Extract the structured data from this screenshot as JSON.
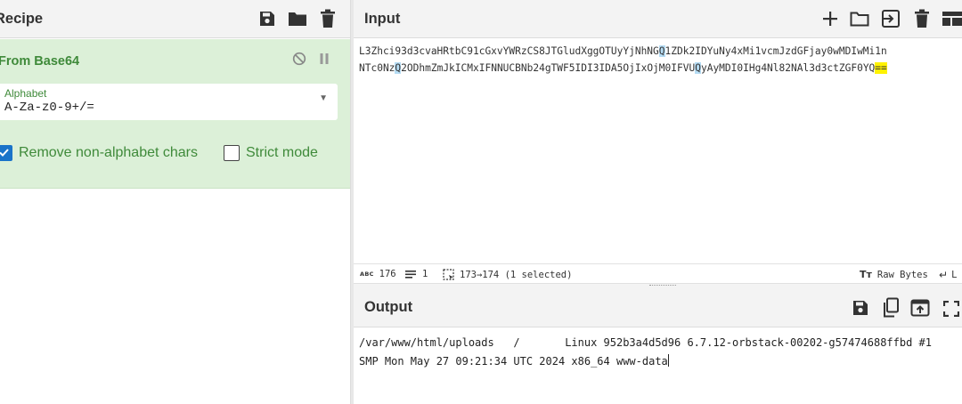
{
  "recipe": {
    "title": "Recipe",
    "operation": {
      "name": "From Base64",
      "alphabet_label": "Alphabet",
      "alphabet_value": "A-Za-z0-9+/=",
      "remove_non_alpha_label": "Remove non-alphabet chars",
      "remove_non_alpha_checked": true,
      "strict_mode_label": "Strict mode",
      "strict_mode_checked": false
    }
  },
  "input": {
    "title": "Input",
    "line1": {
      "a": "L3Zhci93d3cvaHRtbC91cGxvYWRzCS8JTGludXggOTUyYjNhNG",
      "b": "Q",
      "c": "1ZDk2IDYuNy4xMi1vcmJzdGFjay0wMDIwMi1n"
    },
    "line2": {
      "a": "NTc0Nz",
      "b": "Q",
      "c": "2ODhmZmJkICMxIFNNUCBNb24gTWF5IDI3IDA5OjIxOjM0IFVU",
      "d": "Q",
      "e": "yAyMDI0IHg4Nl82NAl3d3ctZGF0YQ",
      "f": "=="
    },
    "status": {
      "length_icon": "abc-icon",
      "length": "176",
      "lines": "1",
      "selection": "173→174 (1 selected)",
      "raw_bytes": "Raw Bytes",
      "line_break_icon": "return-arrow-icon",
      "line_break_text": "L"
    }
  },
  "output": {
    "title": "Output",
    "line1": "/var/www/html/uploads\t/\tLinux 952b3a4d5d96 6.7.12-orbstack-00202-g57474688ffbd #1",
    "line2": "SMP Mon May 27 09:21:34 UTC 2024 x86_64 www-data"
  },
  "colors": {
    "accent_green": "#3f8a3a",
    "operation_bg": "#dcf0d8",
    "highlight_blue": "#b5dcf4",
    "highlight_yellow": "#fff200",
    "checkbox_blue": "#1a73c9"
  }
}
